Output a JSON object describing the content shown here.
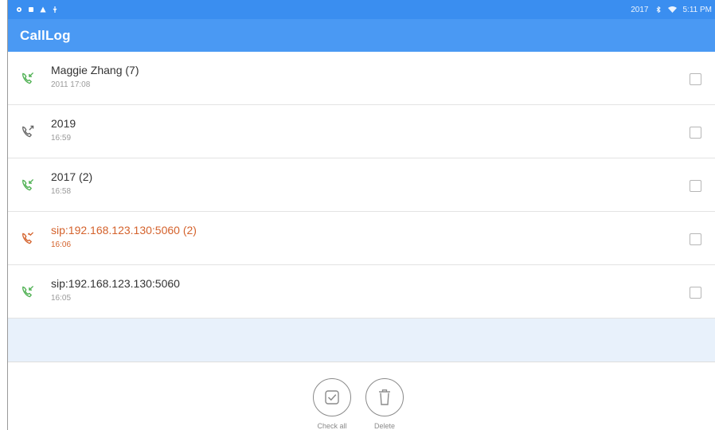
{
  "status_bar": {
    "right_text": "2017",
    "clock": "5:11 PM",
    "left_icons": [
      "notification-icon",
      "sd-card-icon",
      "warning-icon",
      "usb-icon"
    ],
    "right_icons": [
      "bluetooth-icon",
      "wifi-icon"
    ]
  },
  "app_bar": {
    "title": "CallLog",
    "color": "#4a99f3"
  },
  "calls": [
    {
      "name": "Maggie Zhang (7)",
      "time": "2011  17:08",
      "type": "incoming",
      "icon": "incoming-call-icon",
      "color": "#4caf50"
    },
    {
      "name": "2019",
      "time": "16:59",
      "type": "outgoing",
      "icon": "outgoing-call-icon",
      "color": "#666666"
    },
    {
      "name": "2017 (2)",
      "time": "16:58",
      "type": "incoming",
      "icon": "incoming-call-icon",
      "color": "#4caf50"
    },
    {
      "name": "sip:192.168.123.130:5060 (2)",
      "time": "16:06",
      "type": "missed",
      "icon": "missed-call-icon",
      "color": "#d4622c"
    },
    {
      "name": "sip:192.168.123.130:5060",
      "time": "16:05",
      "type": "incoming",
      "icon": "incoming-call-icon",
      "color": "#4caf50"
    }
  ],
  "actions": {
    "check_all": "Check all",
    "delete": "Delete"
  }
}
